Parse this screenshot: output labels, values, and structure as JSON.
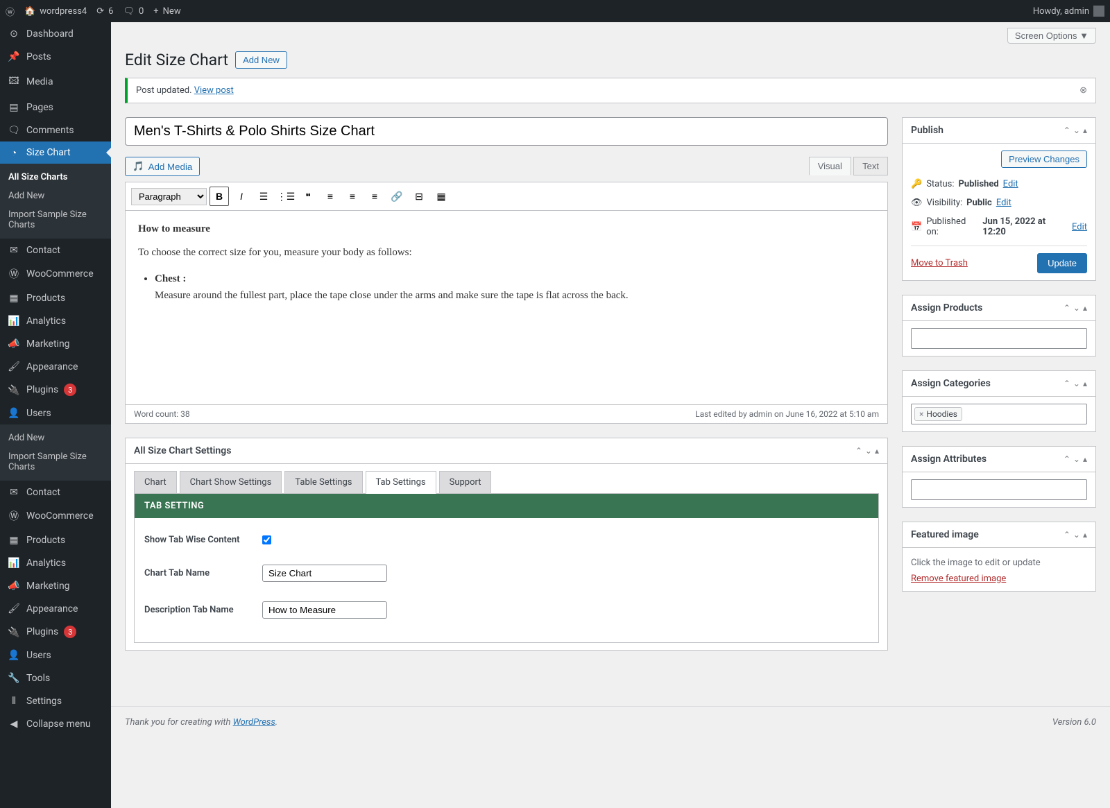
{
  "adminBar": {
    "siteName": "wordpress4",
    "updates": "6",
    "comments": "0",
    "new": "New",
    "howdy": "Howdy, admin"
  },
  "sidebar": {
    "items": [
      {
        "icon": "◐",
        "label": "Dashboard"
      },
      {
        "icon": "✎",
        "label": "Posts"
      },
      {
        "icon": "▣",
        "label": "Media"
      },
      {
        "icon": "▤",
        "label": "Pages"
      },
      {
        "icon": "✉",
        "label": "Comments"
      },
      {
        "icon": "◔",
        "label": "Size Chart",
        "active": true
      },
      {
        "icon": "✉",
        "label": "Contact"
      },
      {
        "icon": "₩",
        "label": "WooCommerce"
      },
      {
        "icon": "▦",
        "label": "Products"
      },
      {
        "icon": "▮",
        "label": "Analytics"
      },
      {
        "icon": "◢",
        "label": "Marketing"
      },
      {
        "icon": "✦",
        "label": "Appearance"
      },
      {
        "icon": "🔌",
        "label": "Plugins",
        "badge": "3"
      },
      {
        "icon": "👤",
        "label": "Users"
      },
      {
        "icon": "✎",
        "label": "Add New",
        "sub": true
      },
      {
        "icon": "",
        "label": "Import Sample Size Charts",
        "sub": true
      },
      {
        "icon": "✉",
        "label": "Contact"
      },
      {
        "icon": "₩",
        "label": "WooCommerce"
      },
      {
        "icon": "▦",
        "label": "Products"
      },
      {
        "icon": "▮",
        "label": "Analytics"
      },
      {
        "icon": "◢",
        "label": "Marketing"
      },
      {
        "icon": "✦",
        "label": "Appearance"
      },
      {
        "icon": "🔌",
        "label": "Plugins",
        "badge": "3"
      },
      {
        "icon": "👤",
        "label": "Users"
      },
      {
        "icon": "🔧",
        "label": "Tools"
      },
      {
        "icon": "▤",
        "label": "Settings"
      },
      {
        "icon": "◀",
        "label": "Collapse menu"
      }
    ],
    "submenu": [
      "All Size Charts",
      "Add New",
      "Import Sample Size Charts"
    ]
  },
  "screenOptions": "Screen Options ▼",
  "header": {
    "title": "Edit Size Chart",
    "addNew": "Add New"
  },
  "notice": {
    "text": "Post updated.",
    "link": "View post"
  },
  "postTitle": "Men's T-Shirts & Polo Shirts Size Chart",
  "addMedia": "Add Media",
  "editorTabs": {
    "visual": "Visual",
    "text": "Text"
  },
  "toolbarFormat": "Paragraph",
  "editorContent": {
    "heading": "How to measure",
    "intro": "To choose the correct size for you, measure your body as follows:",
    "bulletLabel": "Chest :",
    "bulletText": "Measure around the fullest part, place the tape close under the arms and make sure the tape is flat across the back."
  },
  "wordCount": "Word count: 38",
  "lastEdited": "Last edited by admin on June 16, 2022 at 5:10 am",
  "settingsBox": {
    "title": "All Size Chart Settings",
    "tabs": [
      "Chart",
      "Chart Show Settings",
      "Table Settings",
      "Tab Settings",
      "Support"
    ],
    "sectionHeader": "TAB SETTING",
    "rows": {
      "showTab": "Show Tab Wise Content",
      "chartTab": "Chart Tab Name",
      "chartTabVal": "Size Chart",
      "descTab": "Description Tab Name",
      "descTabVal": "How to Measure"
    }
  },
  "publish": {
    "title": "Publish",
    "preview": "Preview Changes",
    "statusLabel": "Status:",
    "statusVal": "Published",
    "edit": "Edit",
    "visLabel": "Visibility:",
    "visVal": "Public",
    "pubLabel": "Published on:",
    "pubVal": "Jun 15, 2022 at 12:20",
    "trash": "Move to Trash",
    "update": "Update"
  },
  "sideBoxes": {
    "products": "Assign Products",
    "categories": "Assign Categories",
    "catTag": "Hoodies",
    "attributes": "Assign Attributes",
    "featured": "Featured image",
    "featuredText": "Click the image to edit or update",
    "removeFeatured": "Remove featured image"
  },
  "footer": {
    "text": "Thank you for creating with ",
    "link": "WordPress",
    "version": "Version 6.0"
  }
}
